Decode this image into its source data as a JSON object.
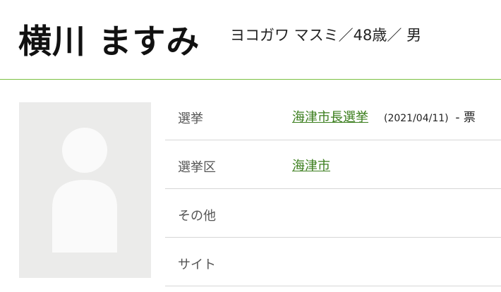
{
  "candidate": {
    "name": "横川 ますみ",
    "kana_age_gender": "ヨコガワ マスミ／48歳／ 男"
  },
  "info": {
    "rows": [
      {
        "label": "選挙",
        "link_text": "海津市長選挙",
        "date": "(2021/04/11)",
        "votes": "- 票"
      },
      {
        "label": "選挙区",
        "link_text": "海津市"
      },
      {
        "label": "その他"
      },
      {
        "label": "サイト"
      }
    ]
  },
  "colors": {
    "link": "#3a7d1c",
    "header_rule": "#7bc043",
    "photo_bg": "#ebebea",
    "silhouette": "#fafafa"
  },
  "icons": {
    "photo_placeholder": "person-silhouette-icon"
  }
}
